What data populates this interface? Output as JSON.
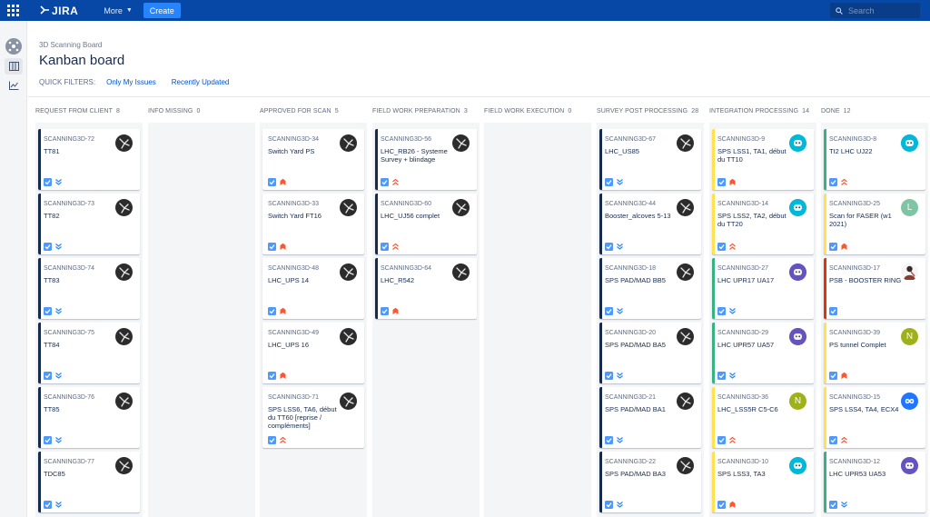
{
  "topnav": {
    "logo_text": "JIRA",
    "more_label": "More",
    "create_label": "Create",
    "search_placeholder": "Search"
  },
  "header": {
    "breadcrumb": "3D Scanning Board",
    "title": "Kanban board",
    "quick_filters_label": "QUICK FILTERS:",
    "filters": [
      "Only My Issues",
      "Recently Updated"
    ]
  },
  "colors": {
    "nav": "#0747a6",
    "flag_dark": "#172b4d",
    "flag_yellow": "#ffe24d",
    "flag_green": "#36b37e",
    "flag_red": "#de350b",
    "task_blue": "#4c9aff",
    "priority_high": "#ff5630",
    "priority_low": "#2684ff"
  },
  "columns": [
    {
      "title": "REQUEST FROM CLIENT",
      "count": "8",
      "cards": [
        {
          "key": "SCANNING3D-72",
          "summary": "TT81",
          "flag": "dark",
          "avatar": "dark",
          "priority": "lowest"
        },
        {
          "key": "SCANNING3D-73",
          "summary": "TT82",
          "flag": "dark",
          "avatar": "dark",
          "priority": "lowest"
        },
        {
          "key": "SCANNING3D-74",
          "summary": "TT83",
          "flag": "dark",
          "avatar": "dark",
          "priority": "lowest"
        },
        {
          "key": "SCANNING3D-75",
          "summary": "TT84",
          "flag": "dark",
          "avatar": "dark",
          "priority": "lowest"
        },
        {
          "key": "SCANNING3D-76",
          "summary": "TT85",
          "flag": "dark",
          "avatar": "dark",
          "priority": "lowest"
        },
        {
          "key": "SCANNING3D-77",
          "summary": "TDC85",
          "flag": "dark",
          "avatar": "dark",
          "priority": "lowest"
        }
      ]
    },
    {
      "title": "INFO MISSING",
      "count": "0",
      "cards": []
    },
    {
      "title": "APPROVED FOR SCAN",
      "count": "5",
      "cards": [
        {
          "key": "SCANNING3D-34",
          "summary": "Switch Yard PS",
          "flag": "none",
          "avatar": "dark",
          "priority": "highest"
        },
        {
          "key": "SCANNING3D-33",
          "summary": "Switch Yard FT16",
          "flag": "none",
          "avatar": "dark",
          "priority": "highest"
        },
        {
          "key": "SCANNING3D-48",
          "summary": "LHC_UPS 14",
          "flag": "none",
          "avatar": "dark",
          "priority": "highest"
        },
        {
          "key": "SCANNING3D-49",
          "summary": "LHC_UPS 16",
          "flag": "none",
          "avatar": "dark",
          "priority": "highest"
        },
        {
          "key": "SCANNING3D-71",
          "summary": "SPS LSS6, TA6, début du TT60 [reprise / compléments]",
          "flag": "none",
          "avatar": "dark",
          "priority": "high"
        }
      ]
    },
    {
      "title": "FIELD WORK PREPARATION",
      "count": "3",
      "cards": [
        {
          "key": "SCANNING3D-56",
          "summary": "LHC_RB26 - Systeme Survey + blindage",
          "flag": "dark",
          "avatar": "dark",
          "priority": "high"
        },
        {
          "key": "SCANNING3D-60",
          "summary": "LHC_UJ56 complet",
          "flag": "dark",
          "avatar": "dark",
          "priority": "high"
        },
        {
          "key": "SCANNING3D-64",
          "summary": "LHC_R542",
          "flag": "dark",
          "avatar": "dark",
          "priority": "highest"
        }
      ]
    },
    {
      "title": "FIELD WORK EXECUTION",
      "count": "0",
      "cards": []
    },
    {
      "title": "SURVEY POST PROCESSING",
      "count": "28",
      "cards": [
        {
          "key": "SCANNING3D-67",
          "summary": "LHC_US85",
          "flag": "dark",
          "avatar": "dark",
          "priority": "lowest"
        },
        {
          "key": "SCANNING3D-44",
          "summary": "Booster_alcoves 5-13",
          "flag": "dark",
          "avatar": "dark",
          "priority": "lowest"
        },
        {
          "key": "SCANNING3D-18",
          "summary": "SPS PAD/MAD BB5",
          "flag": "dark",
          "avatar": "dark",
          "priority": "lowest"
        },
        {
          "key": "SCANNING3D-20",
          "summary": "SPS PAD/MAD BA5",
          "flag": "dark",
          "avatar": "dark",
          "priority": "lowest"
        },
        {
          "key": "SCANNING3D-21",
          "summary": "SPS PAD/MAD BA1",
          "flag": "dark",
          "avatar": "dark",
          "priority": "lowest"
        },
        {
          "key": "SCANNING3D-22",
          "summary": "SPS PAD/MAD BA3",
          "flag": "dark",
          "avatar": "dark",
          "priority": "lowest"
        }
      ]
    },
    {
      "title": "INTEGRATION PROCESSING",
      "count": "14",
      "cards": [
        {
          "key": "SCANNING3D-9",
          "summary": "SPS LSS1, TA1, début du TT10",
          "flag": "yellow",
          "avatar": "teal",
          "priority": "highest"
        },
        {
          "key": "SCANNING3D-14",
          "summary": "SPS LSS2, TA2, début du TT20",
          "flag": "yellow",
          "avatar": "teal",
          "priority": "high"
        },
        {
          "key": "SCANNING3D-27",
          "summary": "LHC UPR17 UA17",
          "flag": "green",
          "avatar": "purple",
          "priority": "lowest"
        },
        {
          "key": "SCANNING3D-29",
          "summary": "LHC UPR57 UA57",
          "flag": "green",
          "avatar": "purple",
          "priority": "lowest"
        },
        {
          "key": "SCANNING3D-36",
          "summary": "LHC_LSS5R C5-C6",
          "flag": "yellow",
          "avatar": "olive",
          "avatar_letter": "N",
          "priority": "high"
        },
        {
          "key": "SCANNING3D-10",
          "summary": "SPS LSS3, TA3",
          "flag": "yellow",
          "avatar": "teal",
          "priority": "highest"
        }
      ]
    },
    {
      "title": "DONE",
      "count": "12",
      "cards": [
        {
          "key": "SCANNING3D-8",
          "summary": "TI2 LHC UJ22",
          "flag": "green",
          "avatar": "teal",
          "priority": "high"
        },
        {
          "key": "SCANNING3D-25",
          "summary": "Scan for FASER (w1 2021)",
          "flag": "yellow",
          "avatar": "sage",
          "avatar_letter": "L",
          "priority": "highest"
        },
        {
          "key": "SCANNING3D-17",
          "summary": "PSB - BOOSTER RING",
          "flag": "red",
          "avatar": "photo",
          "priority": "none"
        },
        {
          "key": "SCANNING3D-39",
          "summary": "PS tunnel Complet",
          "flag": "yellow",
          "avatar": "olive",
          "avatar_letter": "N",
          "priority": "highest"
        },
        {
          "key": "SCANNING3D-15",
          "summary": "SPS LSS4, TA4, ECX4",
          "flag": "yellow",
          "avatar": "blue",
          "priority": "high"
        },
        {
          "key": "SCANNING3D-12",
          "summary": "LHC UPR53 UA53",
          "flag": "green",
          "avatar": "purple",
          "priority": "lowest"
        }
      ]
    }
  ]
}
